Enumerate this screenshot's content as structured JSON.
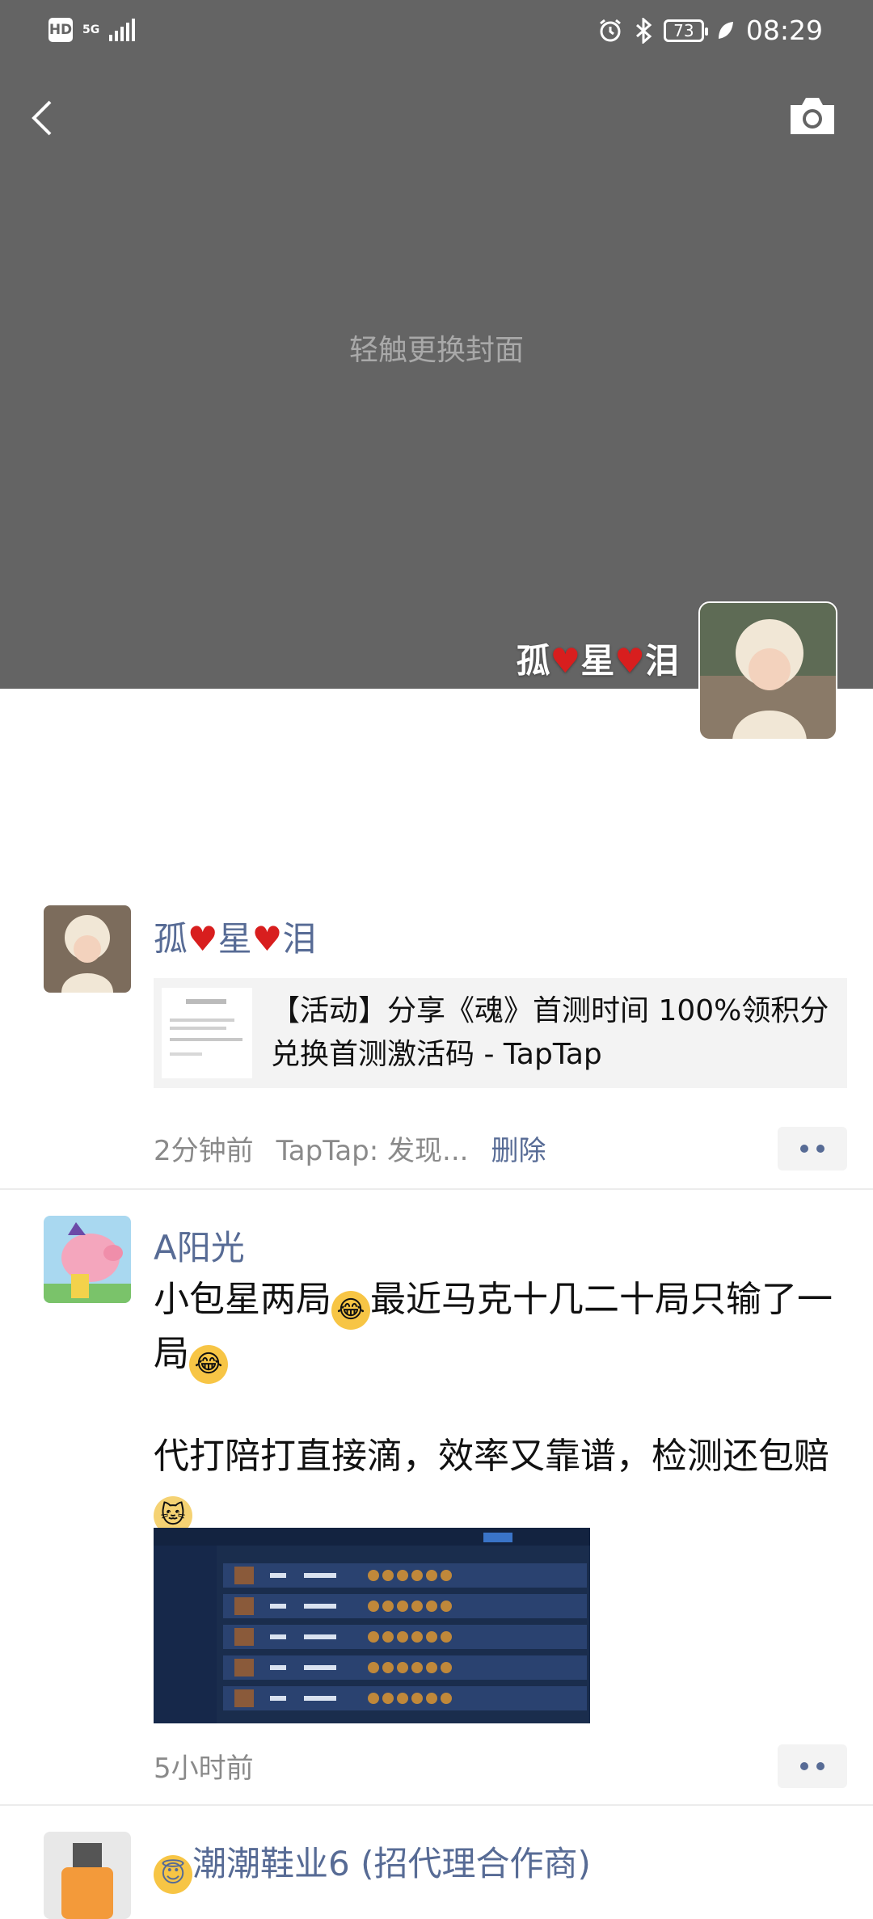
{
  "status_bar": {
    "hd": "HD",
    "network": "5G",
    "battery": "73",
    "time": "08:29"
  },
  "cover": {
    "hint": "轻触更换封面",
    "profile_name": "孤♥星♥泪"
  },
  "posts": [
    {
      "user": "孤♥星♥泪",
      "link_title": "【活动】分享《魂》首测时间 100%领积分兑换首测激活码 - TapTap",
      "time": "2分钟前",
      "source": "TapTap: 发现...",
      "delete_label": "删除"
    },
    {
      "user": "A阳光",
      "text_line1": "小包星两局",
      "text_line1b": "最近马克十几二十局只输了一局",
      "text_line2": "代打陪打直接滴，效率又靠谱，检测还包赔",
      "time": "5小时前"
    },
    {
      "user": "潮潮鞋业6 (招代理合作商)"
    }
  ],
  "icons": {
    "back": "chevron-left-icon",
    "camera": "camera-icon"
  },
  "colors": {
    "cover_bg": "#646464",
    "link_blue": "#576b95",
    "heart_red": "#d81e1e"
  }
}
